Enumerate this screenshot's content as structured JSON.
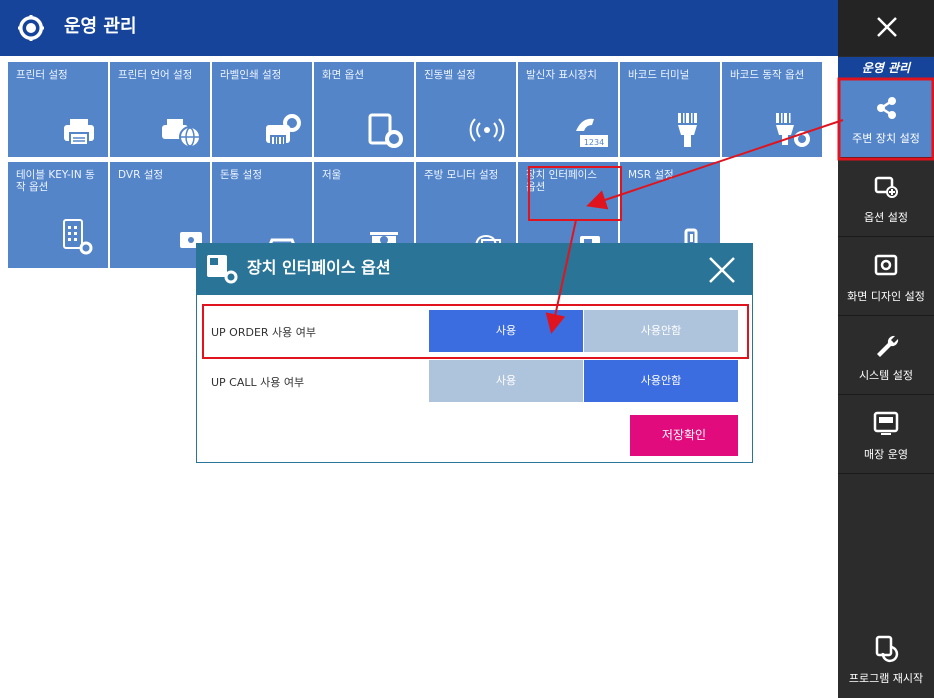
{
  "header": {
    "title": "운영 관리",
    "icon": "gear-icon"
  },
  "tiles": [
    {
      "label": "프린터 설정",
      "icon": "printer-icon"
    },
    {
      "label": "프린터 언어 설정",
      "icon": "printer-globe-icon"
    },
    {
      "label": "라벨인쇄 설정",
      "icon": "label-printer-icon"
    },
    {
      "label": "화면 옵션",
      "icon": "screen-gear-icon"
    },
    {
      "label": "진동벨 설정",
      "icon": "vibration-bell-icon"
    },
    {
      "label": "발신자 표시장치",
      "icon": "caller-id-icon"
    },
    {
      "label": "바코드 터미널",
      "icon": "barcode-terminal-icon"
    },
    {
      "label": "바코드 동작 옵션",
      "icon": "barcode-gear-icon"
    },
    {
      "label": "테이블 KEY-IN 동작 옵션",
      "icon": "keypad-gear-icon"
    },
    {
      "label": "DVR 설정",
      "icon": "camera-icon"
    },
    {
      "label": "돈통 설정",
      "icon": "cash-drawer-icon"
    },
    {
      "label": "저울",
      "icon": "scale-icon"
    },
    {
      "label": "주방 모니터 설정",
      "icon": "kitchen-monitor-icon"
    },
    {
      "label": "장치 인터페이스 옵션",
      "icon": "device-interface-icon"
    },
    {
      "label": "MSR 설정",
      "icon": "msr-icon"
    }
  ],
  "sidebar": {
    "close_icon": "close-icon",
    "title": "운영 관리",
    "items": [
      {
        "label": "주변 장치 설정",
        "icon": "share-icon"
      },
      {
        "label": "옵션 설정",
        "icon": "option-icon"
      },
      {
        "label": "화면 디자인 설정",
        "icon": "screen-design-icon"
      },
      {
        "label": "시스템 설정",
        "icon": "wrench-icon"
      },
      {
        "label": "매장 운영",
        "icon": "store-operation-icon"
      },
      {
        "label": "프로그램 재시작",
        "icon": "restart-icon"
      }
    ]
  },
  "dialog": {
    "title": "장치 인터페이스 옵션",
    "rows": [
      {
        "label": "UP ORDER 사용 여부",
        "use": "사용",
        "not_use": "사용안함",
        "selected": "use"
      },
      {
        "label": "UP CALL 사용 여부",
        "use": "사용",
        "not_use": "사용안함",
        "selected": "not_use"
      }
    ],
    "save": "저장확인"
  },
  "colors": {
    "header": "#15449a",
    "tile": "#5485c9",
    "sidebar": "#2c2c2c",
    "dialog_header": "#2a7497",
    "selected": "#3b6ce0",
    "unselected": "#aec3dc",
    "save": "#e10b7d",
    "annotation": "#e0141e"
  }
}
